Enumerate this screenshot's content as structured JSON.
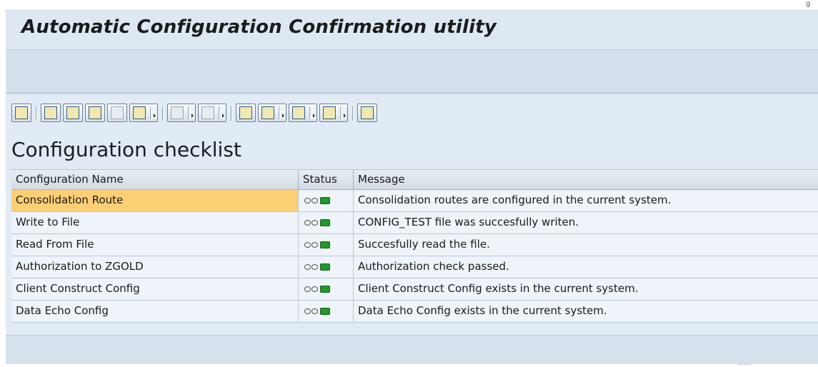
{
  "window": {
    "title": "Automatic Configuration Confirmation utility"
  },
  "toolbar": {
    "buttons": [
      {
        "name": "details-icon",
        "dropdown": false,
        "enabled": true
      },
      {
        "name": "sort-ascending-icon",
        "dropdown": false,
        "enabled": true
      },
      {
        "name": "sort-descending-icon",
        "dropdown": false,
        "enabled": true
      },
      {
        "name": "find-icon",
        "dropdown": false,
        "enabled": true
      },
      {
        "name": "find-next-icon",
        "dropdown": false,
        "enabled": false
      },
      {
        "name": "filter-icon",
        "dropdown": true,
        "enabled": true
      },
      {
        "name": "total-icon",
        "dropdown": true,
        "enabled": false
      },
      {
        "name": "subtotal-icon",
        "dropdown": true,
        "enabled": false
      },
      {
        "name": "print-icon",
        "dropdown": false,
        "enabled": true
      },
      {
        "name": "views-icon",
        "dropdown": true,
        "enabled": true
      },
      {
        "name": "export-icon",
        "dropdown": true,
        "enabled": true
      },
      {
        "name": "layout-icon",
        "dropdown": true,
        "enabled": true
      },
      {
        "name": "graphic-icon",
        "dropdown": false,
        "enabled": true
      }
    ]
  },
  "report": {
    "heading": "Configuration checklist",
    "columns": [
      "Configuration Name",
      "Status",
      "Message"
    ],
    "rows": [
      {
        "name": "Consolidation Route",
        "status": "green",
        "message": "Consolidation routes are configured in the current system.",
        "selected": true
      },
      {
        "name": "Write to File",
        "status": "green",
        "message": "CONFIG_TEST file was succesfully writen.",
        "selected": false
      },
      {
        "name": "Read From File",
        "status": "green",
        "message": "Succesfully read the file.",
        "selected": false
      },
      {
        "name": "Authorization to ZGOLD",
        "status": "green",
        "message": "Authorization check passed.",
        "selected": false
      },
      {
        "name": "Client Construct Config",
        "status": "green",
        "message": "Client Construct Config exists in the current system.",
        "selected": false
      },
      {
        "name": "Data Echo Config",
        "status": "green",
        "message": "Data Echo Config exists in the current system.",
        "selected": false
      }
    ]
  },
  "colors": {
    "title_bar": "#dde8f3",
    "content_bg": "#e1ebf5",
    "selected_cell": "#fccf75",
    "status_green": "#1e9b28"
  }
}
